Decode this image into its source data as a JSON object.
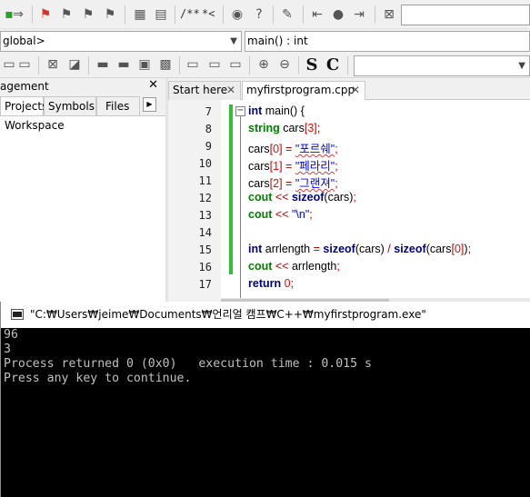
{
  "toolbar": {
    "comment_stream_label": "/**",
    "comment_line_label": "*<",
    "scope_combo": "global>",
    "function_combo": "main() : int",
    "style_s_label": "S",
    "style_c_label": "C"
  },
  "management": {
    "title": "agement",
    "close_label": "✕",
    "tabs": [
      "Projects",
      "Symbols",
      "Files"
    ],
    "active_tab": "Projects",
    "tree_root": "Workspace"
  },
  "editor": {
    "tabs": [
      {
        "label": "Start here",
        "close": "✕",
        "active": false
      },
      {
        "label": "myfirstprogram.cpp",
        "close": "✕",
        "active": true
      }
    ],
    "line_numbers": [
      "7",
      "8",
      "9",
      "10",
      "11",
      "12",
      "13",
      "14",
      "15",
      "16",
      "17"
    ],
    "code_lines": [
      "int main() {",
      "string cars[3];",
      "cars[0] = \"포르쉐\";",
      "cars[1] = \"페라리\";",
      "cars[2] = \"그랜져\";",
      "cout << sizeof(cars);",
      "cout << \"\\n\";",
      "",
      "int arrlength = sizeof(cars) / sizeof(cars[0]);",
      "cout << arrlength;",
      "return 0;"
    ]
  },
  "console": {
    "title": "\"C:₩Users₩jeime₩Documents₩언리얼 캠프₩C++₩myfirstprogram.exe\"",
    "lines": [
      "96",
      "3",
      "Process returned 0 (0x0)   execution time : 0.015 s",
      "Press any key to continue."
    ]
  },
  "colors": {
    "keyword": "#00007f",
    "type": "#007f00",
    "string": "#0000ff",
    "number": "#ff0000",
    "operator": "#c00000",
    "change_bar": "#2ec22e",
    "console_text": "#c0c0c0",
    "console_bg": "#000000"
  }
}
